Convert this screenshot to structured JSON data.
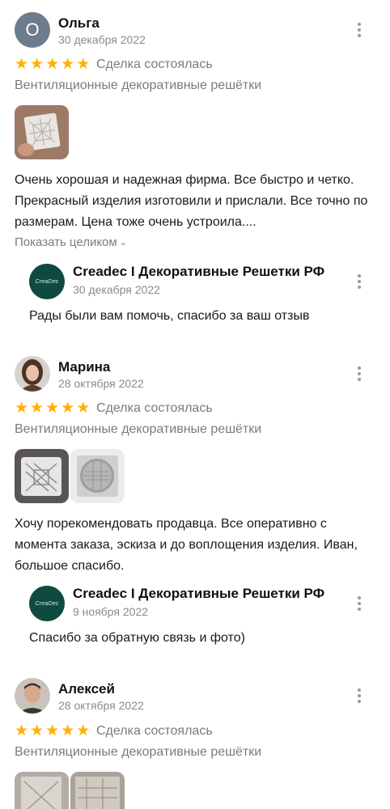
{
  "reviews": [
    {
      "avatar_letter": "О",
      "name": "Ольга",
      "date": "30 декабря 2022",
      "rating": 5,
      "deal_status": "Сделка состоялась",
      "category": "Вентиляционные декоративные решётки",
      "text": "Очень хорошая и надежная фирма. Все быстро и четко. Прекрасный изделия изготовили и прислали. Все точно по размерам. Цена тоже очень устроила....",
      "show_more": "Показать целиком",
      "reply": {
        "logo_text": "CreaDec",
        "shop_name": "Creadec I Декоративные Решетки РФ",
        "date": "30 декабря 2022",
        "text": "Рады были вам помочь, спасибо за ваш отзыв"
      }
    },
    {
      "name": "Марина",
      "date": "28 октября 2022",
      "rating": 5,
      "deal_status": "Сделка состоялась",
      "category": "Вентиляционные декоративные решётки",
      "text": "Хочу порекомендовать продавца. Все оперативно с момента заказа, эскиза и до воплощения изделия. Иван, большое спасибо.",
      "reply": {
        "logo_text": "CreaDec",
        "shop_name": "Creadec I Декоративные Решетки РФ",
        "date": "9 ноября 2022",
        "text": "Спасибо за обратную связь и фото)"
      }
    },
    {
      "name": "Алексей",
      "date": "28 октября 2022",
      "rating": 5,
      "deal_status": "Сделка состоялась",
      "category": "Вентиляционные декоративные решётки"
    }
  ],
  "icons": {
    "star": "★",
    "chevron": "⌄"
  },
  "colors": {
    "star": "#ffb000",
    "muted_text": "#7b7b7b",
    "shop_logo_bg": "#0e4a40",
    "avatar_bg": "#6c7c8c"
  }
}
